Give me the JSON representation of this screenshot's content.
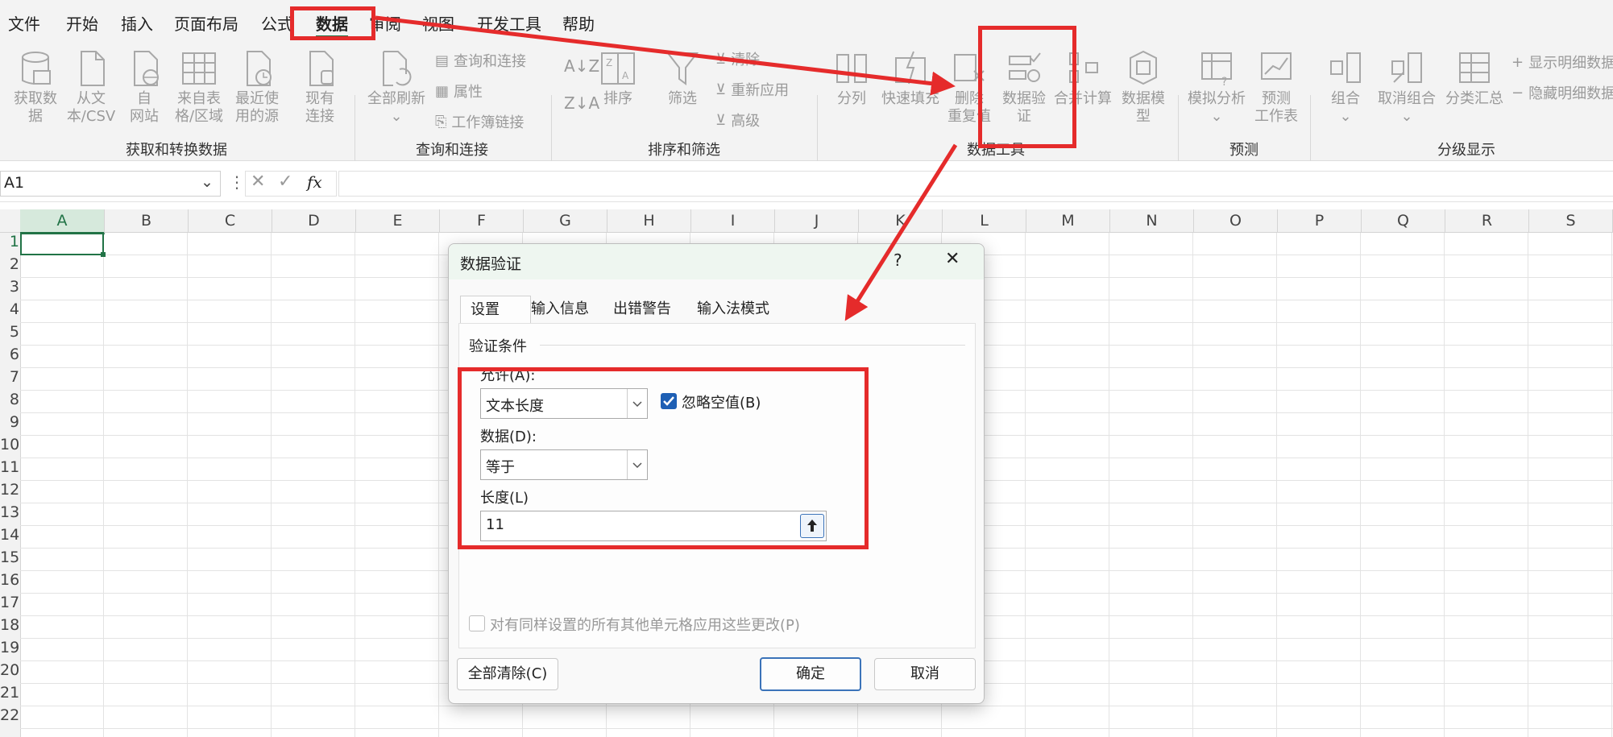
{
  "menu": [
    "文件",
    "开始",
    "插入",
    "页面布局",
    "公式",
    "数据",
    "审阅",
    "视图",
    "开发工具",
    "帮助"
  ],
  "ribbon": {
    "get_data": [
      "获取数",
      "据"
    ],
    "from_csv": [
      "从文",
      "本/CSV"
    ],
    "from_web": [
      "自",
      "网站"
    ],
    "from_table": [
      "来自表",
      "格/区域"
    ],
    "recent_sources": [
      "最近使",
      "用的源"
    ],
    "existing": [
      "现有",
      "连接"
    ],
    "refresh_all": "全部刷新",
    "queries_connections": "查询和连接",
    "properties": "属性",
    "workbook_links": "工作簿链接",
    "sort": "排序",
    "filter": "筛选",
    "clear": "清除",
    "reapply": "重新应用",
    "advanced": "高级",
    "split": "分列",
    "flash_fill": "快速填充",
    "remove_dup": [
      "删除",
      "重复值"
    ],
    "data_validation": [
      "数据验",
      "证"
    ],
    "consolidate": "合并计算",
    "data_model": [
      "数据模",
      "型"
    ],
    "what_if": "模拟分析",
    "forecast_sheet": [
      "预测",
      "工作表"
    ],
    "group": "组合",
    "ungroup": "取消组合",
    "subtotal": "分类汇总",
    "show_detail": "显示明细数据",
    "hide_detail": "隐藏明细数据",
    "groups": {
      "get_transform": "获取和转换数据",
      "queries": "查询和连接",
      "sort_filter": "排序和筛选",
      "data_tools": "数据工具",
      "forecast": "预测",
      "outline": "分级显示"
    }
  },
  "formula_bar": {
    "name_box": "A1",
    "fx": "fx",
    "value": ""
  },
  "columns": [
    "A",
    "B",
    "C",
    "D",
    "E",
    "F",
    "G",
    "H",
    "I",
    "J",
    "K",
    "L",
    "M",
    "N",
    "O",
    "P",
    "Q",
    "R",
    "S"
  ],
  "rows": [
    "1",
    "2",
    "3",
    "4",
    "5",
    "6",
    "7",
    "8",
    "9",
    "10",
    "11",
    "12",
    "13",
    "14",
    "15",
    "16",
    "17",
    "18",
    "19",
    "20",
    "21",
    "22"
  ],
  "dialog": {
    "title": "数据验证",
    "help": "?",
    "close": "✕",
    "tabs": [
      "设置",
      "输入信息",
      "出错警告",
      "输入法模式"
    ],
    "section": "验证条件",
    "allow_label": "允许(A):",
    "allow_value": "文本长度",
    "ignore_blank": "忽略空值(B)",
    "data_label": "数据(D):",
    "data_value": "等于",
    "length_label": "长度(L)",
    "length_value": "11",
    "apply_all": "对有同样设置的所有其他单元格应用这些更改(P)",
    "clear_all": "全部清除(C)",
    "ok": "确定",
    "cancel": "取消"
  },
  "colors": {
    "annotation": "#e52b2b",
    "excel_green": "#217346",
    "checkbox_blue": "#1e5fb4"
  }
}
